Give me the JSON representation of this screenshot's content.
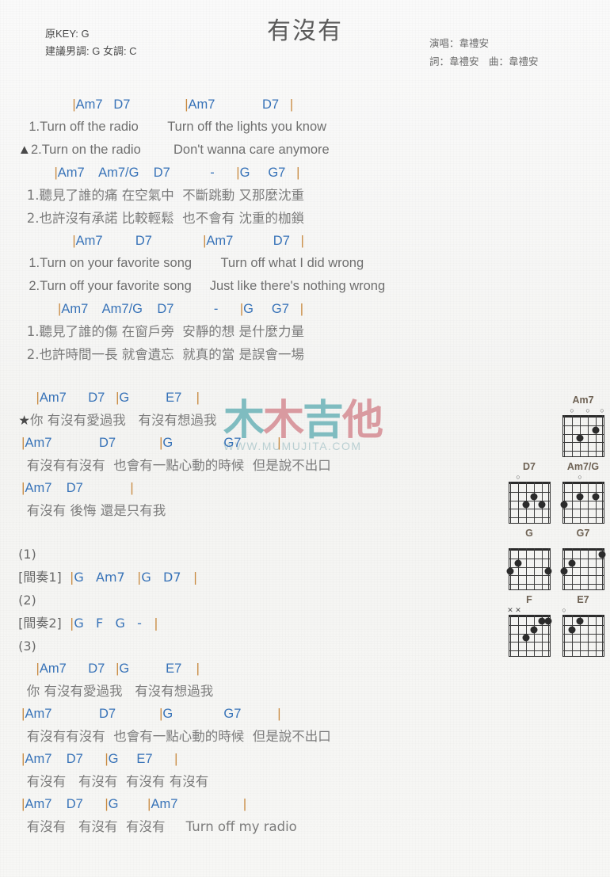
{
  "header": {
    "title": "有沒有",
    "orig_key": "原KEY: G",
    "suggest_key": "建議男調: G 女調: C",
    "singer": "演唱：韋禮安",
    "writer": "詞：韋禮安　曲：韋禮安"
  },
  "watermark": {
    "chars": [
      "木",
      "木",
      "吉",
      "他"
    ],
    "url": "WWW.MUMUJITA.COM",
    "color_teal": "#7fbcc0",
    "color_pink": "#d99aa0"
  },
  "colors": {
    "chord": "#3873b8",
    "lyric": "#7b7b7b",
    "barline": "#c8893f",
    "page_bg": "#f7f7f5"
  },
  "sections": [
    {
      "name": "verse-1",
      "lines": [
        {
          "type": "chord",
          "text": "                |Am7   D7               |Am7             D7   |"
        },
        {
          "type": "lyric_en",
          "text": "    1.Turn off the radio        Turn off the lights you know"
        },
        {
          "type": "lyric_en",
          "text": " ▲2.Turn on the radio         Don't wanna care anymore"
        },
        {
          "type": "chord",
          "text": "           |Am7    Am7/G    D7           -      |G     G7   |"
        },
        {
          "type": "lyric_cn",
          "text": "   1.聽見了誰的痛 在空氣中  不斷跳動 又那麼沈重"
        },
        {
          "type": "lyric_cn",
          "text": "   2.也許沒有承諾 比較輕鬆  也不會有 沈重的枷鎖"
        }
      ]
    },
    {
      "name": "verse-2",
      "lines": [
        {
          "type": "chord",
          "text": "                |Am7         D7              |Am7           D7   |"
        },
        {
          "type": "lyric_en",
          "text": "    1.Turn on your favorite song        Turn off what I did wrong"
        },
        {
          "type": "lyric_en",
          "text": "    2.Turn off your favorite song     Just like there's nothing wrong"
        },
        {
          "type": "chord",
          "text": "            |Am7    Am7/G    D7           -      |G     G7   |"
        },
        {
          "type": "lyric_cn",
          "text": "   1.聽見了誰的傷 在窗戶旁  安靜的想 是什麼力量"
        },
        {
          "type": "lyric_cn",
          "text": "   2.也許時間一長 就會遺忘  就真的當 是誤會一場"
        }
      ]
    },
    {
      "name": "chorus-1",
      "lines": [
        {
          "type": "spacer",
          "text": ""
        },
        {
          "type": "chord",
          "text": "      |Am7      D7   |G          E7    |"
        },
        {
          "type": "lyric_cn",
          "text": " ★你 有沒有愛過我   有沒有想過我"
        },
        {
          "type": "chord",
          "text": "  |Am7             D7            |G              G7          |"
        },
        {
          "type": "lyric_cn",
          "text": "   有沒有有沒有  也會有一點心動的時候  但是說不出口"
        },
        {
          "type": "chord",
          "text": "  |Am7    D7             |"
        },
        {
          "type": "lyric_cn",
          "text": "   有沒有 後悔 還是只有我"
        }
      ]
    },
    {
      "name": "interlude",
      "lines": [
        {
          "type": "spacer",
          "text": ""
        },
        {
          "type": "sect",
          "text": " (1)"
        },
        {
          "type": "sect",
          "text": " [間奏1]  |G   Am7   |G   D7   |"
        },
        {
          "type": "sect",
          "text": " (2)"
        },
        {
          "type": "sect",
          "text": " [間奏2]  |G   F   G   -   |"
        },
        {
          "type": "sect",
          "text": " (3)"
        }
      ]
    },
    {
      "name": "chorus-2",
      "lines": [
        {
          "type": "chord",
          "text": "      |Am7      D7   |G          E7    |"
        },
        {
          "type": "lyric_cn",
          "text": "   你 有沒有愛過我   有沒有想過我"
        },
        {
          "type": "chord",
          "text": "  |Am7             D7            |G              G7          |"
        },
        {
          "type": "lyric_cn",
          "text": "   有沒有有沒有  也會有一點心動的時候  但是說不出口"
        },
        {
          "type": "chord",
          "text": "  |Am7    D7      |G     E7      |"
        },
        {
          "type": "lyric_cn",
          "text": "   有沒有   有沒有  有沒有 有沒有"
        },
        {
          "type": "chord",
          "text": "  |Am7    D7      |G        |Am7                  |"
        },
        {
          "type": "lyric_cn",
          "text": "   有沒有   有沒有  有沒有     Turn off my radio"
        }
      ]
    }
  ],
  "chord_diagrams": [
    {
      "name": "Am7",
      "row": 0,
      "col": 1,
      "open_markers": [
        {
          "string": 1,
          "sym": "o"
        },
        {
          "string": 3,
          "sym": "o"
        },
        {
          "string": 5,
          "sym": "o"
        }
      ],
      "dots": [
        {
          "string": 2,
          "fret": 2
        },
        {
          "string": 4,
          "fret": 1
        }
      ]
    },
    {
      "name": "D7",
      "row": 1,
      "col": 0,
      "open_markers": [
        {
          "string": 1,
          "sym": "o"
        }
      ],
      "dots": [
        {
          "string": 2,
          "fret": 2
        },
        {
          "string": 3,
          "fret": 1
        },
        {
          "string": 4,
          "fret": 2
        }
      ]
    },
    {
      "name": "Am7/G",
      "row": 1,
      "col": 1,
      "open_markers": [
        {
          "string": 2,
          "sym": "o"
        }
      ],
      "dots": [
        {
          "string": 0,
          "fret": 2
        },
        {
          "string": 2,
          "fret": 1
        },
        {
          "string": 4,
          "fret": 1
        }
      ]
    },
    {
      "name": "G",
      "row": 2,
      "col": 0,
      "open_markers": [],
      "dots": [
        {
          "string": 0,
          "fret": 2
        },
        {
          "string": 1,
          "fret": 1
        },
        {
          "string": 5,
          "fret": 2
        }
      ]
    },
    {
      "name": "G7",
      "row": 2,
      "col": 1,
      "open_markers": [],
      "dots": [
        {
          "string": 0,
          "fret": 2
        },
        {
          "string": 1,
          "fret": 1
        },
        {
          "string": 5,
          "fret": 0
        }
      ]
    },
    {
      "name": "F",
      "row": 3,
      "col": 0,
      "open_markers": [
        {
          "string": 0,
          "sym": "x"
        },
        {
          "string": 1,
          "sym": "x"
        }
      ],
      "dots": [
        {
          "string": 2,
          "fret": 2
        },
        {
          "string": 3,
          "fret": 1
        },
        {
          "string": 4,
          "fret": 0
        },
        {
          "string": 5,
          "fret": 0
        }
      ]
    },
    {
      "name": "E7",
      "row": 3,
      "col": 1,
      "open_markers": [
        {
          "string": 0,
          "sym": "o"
        }
      ],
      "dots": [
        {
          "string": 1,
          "fret": 1
        },
        {
          "string": 2,
          "fret": 0
        }
      ]
    }
  ]
}
